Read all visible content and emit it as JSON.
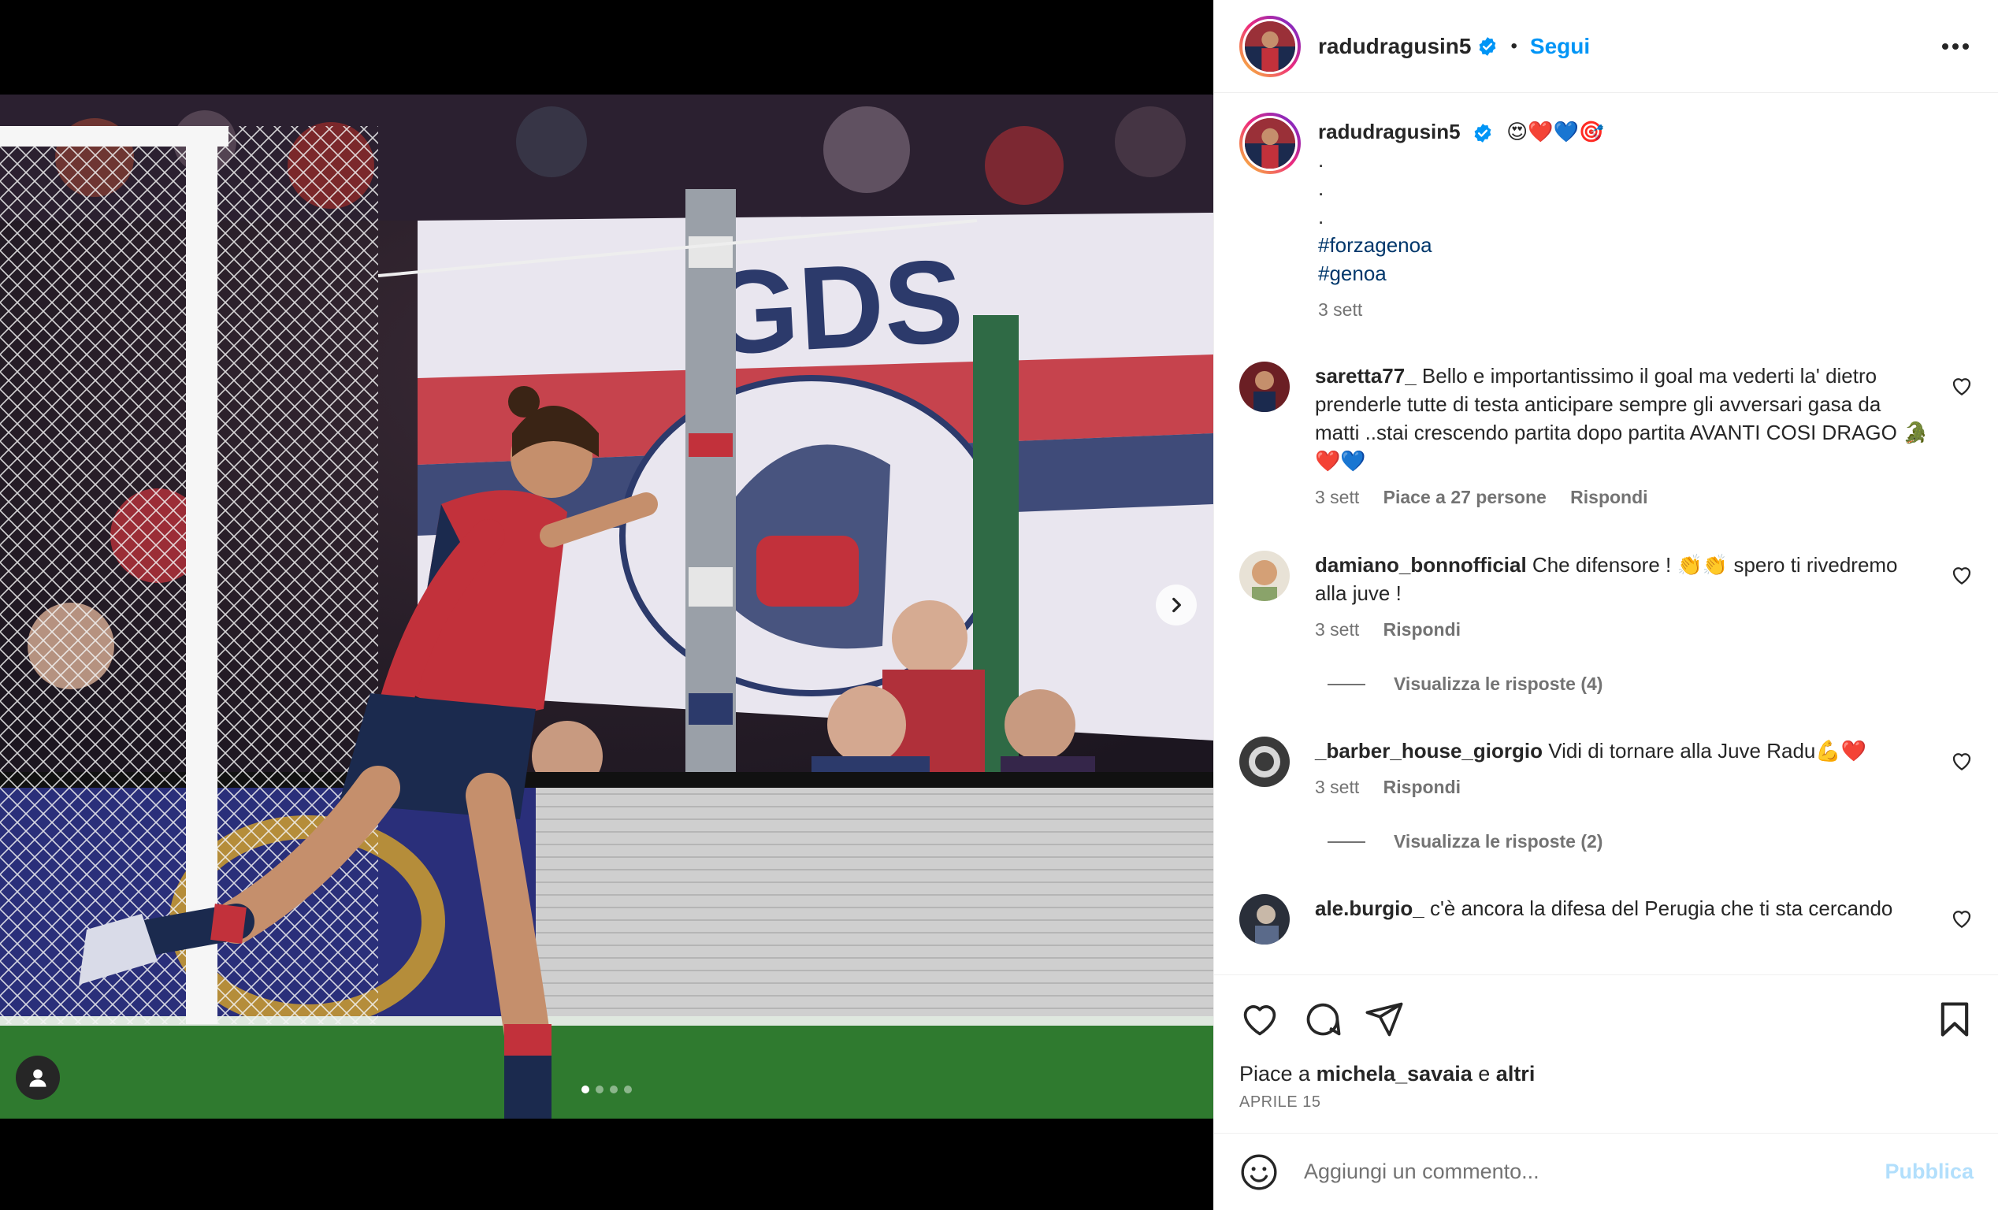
{
  "post": {
    "username": "radudragusin5",
    "follow_label": "Segui",
    "separator": "•",
    "caption_emojis": "😍❤️💙🎯",
    "caption_dots": [
      ".",
      ".",
      "."
    ],
    "hashtags": [
      "#forzagenoa",
      "#genoa"
    ],
    "caption_time": "3 sett"
  },
  "media": {
    "slide_count": 4,
    "active_slide": 0
  },
  "comments": [
    {
      "username": "saretta77_",
      "text": "Bello e importantissimo il goal ma vederti la' dietro prenderle tutte di testa anticipare sempre gli avversari gasa da matti ..stai crescendo partita dopo partita AVANTI COSI DRAGO 🐊❤️💙",
      "time": "3 sett",
      "likes": "Piace a 27 persone",
      "reply": "Rispondi"
    },
    {
      "username": "damiano_bonnofficial",
      "text": "Che difensore ! 👏👏 spero ti rivedremo alla juve !",
      "time": "3 sett",
      "reply": "Rispondi",
      "view_replies": "Visualizza le risposte (4)"
    },
    {
      "username": "_barber_house_giorgio",
      "text": "Vidi di tornare alla Juve Radu💪❤️",
      "time": "3 sett",
      "reply": "Rispondi",
      "view_replies": "Visualizza le risposte (2)"
    },
    {
      "username": "ale.burgio_",
      "text": "c'è ancora la difesa del Perugia che ti sta cercando"
    }
  ],
  "likes": {
    "prefix": "Piace a",
    "user": "michela_savaia",
    "conj": "e",
    "others": "altri"
  },
  "date": "APRILE 15",
  "add_comment": {
    "placeholder": "Aggiungi un commento...",
    "publish_label": "Pubblica"
  },
  "colors": {
    "accent_blue": "#0095f6",
    "hashtag": "#00376b",
    "secondary_text": "#737373",
    "genoa_red": "#c8102e",
    "genoa_navy": "#1b2a4e"
  }
}
